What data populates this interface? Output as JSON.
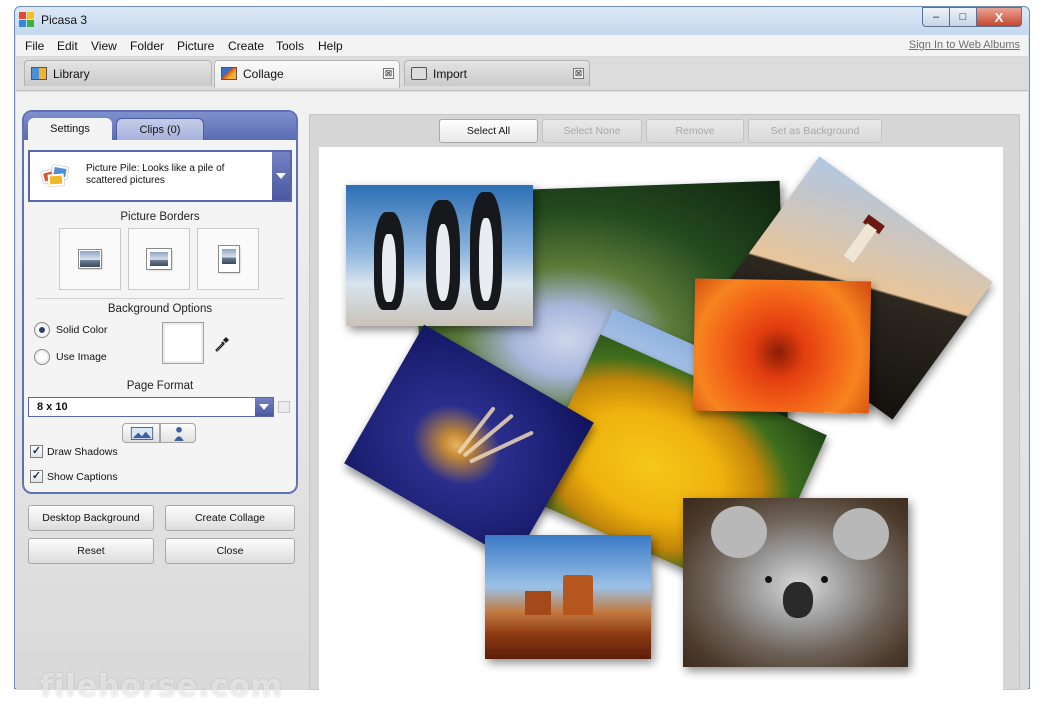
{
  "window": {
    "title": "Picasa 3",
    "minimize": "–",
    "maximize": "□",
    "close": "X"
  },
  "menu": {
    "items": [
      "File",
      "Edit",
      "View",
      "Folder",
      "Picture",
      "Create",
      "Tools",
      "Help"
    ],
    "sign_in": "Sign In to Web Albums"
  },
  "tabs": [
    {
      "label": "Library",
      "icon": "library-grid-icon"
    },
    {
      "label": "Collage",
      "icon": "collage-icon",
      "close": "⊠"
    },
    {
      "label": "Import",
      "icon": "camera-icon",
      "close": "⊠"
    }
  ],
  "panel": {
    "tabs": {
      "settings": "Settings",
      "clips": "Clips (0)"
    },
    "collage_style": "Picture Pile:  Looks like a pile of scattered pictures",
    "borders_title": "Picture Borders",
    "background_title": "Background Options",
    "solid_color": "Solid Color",
    "use_image": "Use Image",
    "solid_color_selected": true,
    "background_color": "#ffffff",
    "page_format_title": "Page Format",
    "page_format": "8 x 10",
    "draw_shadows": "Draw Shadows",
    "draw_shadows_checked": true,
    "show_captions": "Show Captions",
    "show_captions_checked": true,
    "check_mark": "✓",
    "buttons": {
      "desktop_background": "Desktop Background",
      "create_collage": "Create Collage",
      "reset": "Reset",
      "close": "Close"
    }
  },
  "actions": {
    "select_all": "Select All",
    "select_none": "Select None",
    "remove": "Remove",
    "set_background": "Set as Background"
  },
  "watermark": "filehorse.com",
  "colors": {
    "accent": "#5b6db3",
    "title_bar": "#cfe0f3",
    "close_button": "#c5462e"
  }
}
